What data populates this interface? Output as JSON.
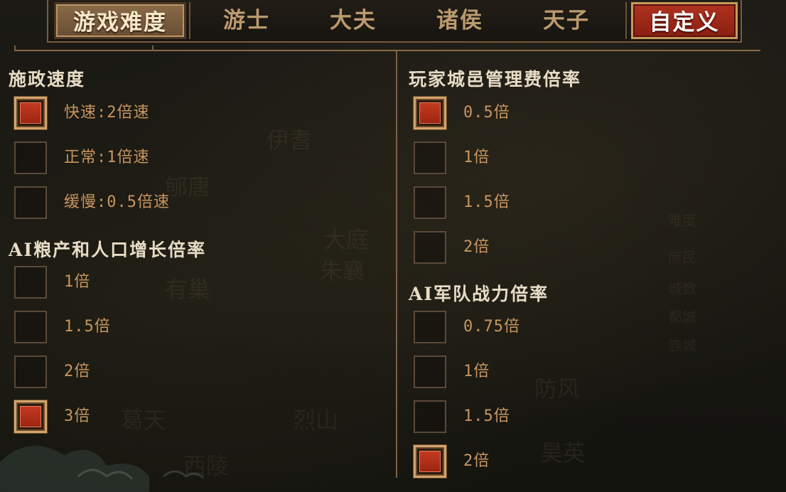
{
  "tabs": {
    "difficulty_label": "游戏难度",
    "items": [
      "游士",
      "大夫",
      "诸侯",
      "天子"
    ],
    "custom_label": "自定义"
  },
  "left": {
    "policy_speed": {
      "title": "施政速度",
      "options": [
        "快速:2倍速",
        "正常:1倍速",
        "缓慢:0.5倍速"
      ],
      "selected_index": 0
    },
    "ai_growth": {
      "title": "AI粮产和人口增长倍率",
      "options": [
        "1倍",
        "1.5倍",
        "2倍",
        "3倍"
      ],
      "selected_index": 3
    }
  },
  "right": {
    "city_fee": {
      "title": "玩家城邑管理费倍率",
      "options": [
        "0.5倍",
        "1倍",
        "1.5倍",
        "2倍"
      ],
      "selected_index": 0
    },
    "ai_military": {
      "title": "AI军队战力倍率",
      "options": [
        "0.75倍",
        "1倍",
        "1.5倍",
        "2倍"
      ],
      "selected_index": 3
    }
  },
  "background_labels": [
    "伊耆",
    "郇唐",
    "大庭",
    "朱襄",
    "烈山",
    "防风",
    "昊英",
    "有巢",
    "西陵",
    "葛天",
    "难度",
    "庶民",
    "城数",
    "都城",
    "族城"
  ],
  "colors": {
    "active_tab": "#6a4e34",
    "custom_tab": "#a32a18",
    "checkbox_fill": "#b52f19",
    "option_text": "#c8955e",
    "title_text": "#e8dcc6"
  }
}
